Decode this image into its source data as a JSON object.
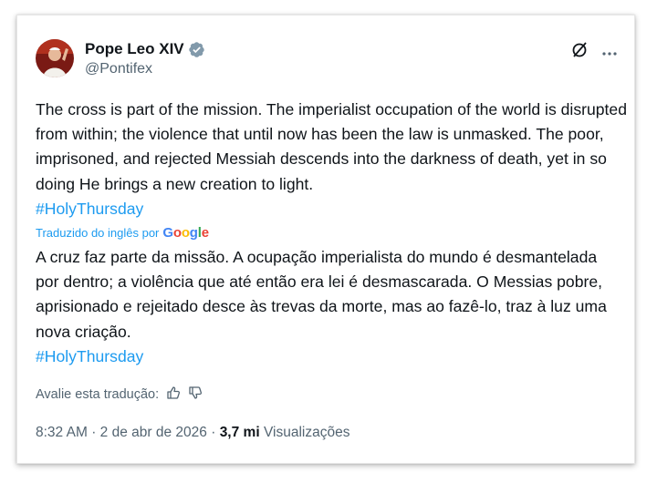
{
  "author": {
    "name": "Pope Leo XIV",
    "handle": "@Pontifex",
    "verified_icon": "verified-badge-icon",
    "verified_color": "#829aab"
  },
  "tweet": {
    "text": "The cross is part of the mission. The imperialist occupation of the world is disrupted from within; the violence that until now has been the law is unmasked. The poor, imprisoned, and rejected Messiah descends into the darkness of death, yet in so doing He brings a new creation to light.",
    "hashtag": "#HolyThursday"
  },
  "translation": {
    "label": "Traduzido do inglês por",
    "provider": "Google",
    "text": "A cruz faz parte da missão. A ocupação imperialista do mundo é desmantelada por dentro; a violência que até então era lei é desmascarada. O Messias pobre, aprisionado e rejeitado desce às trevas da morte, mas ao fazê-lo, traz à luz uma nova criação.",
    "hashtag": "#HolyThursday",
    "rate_label": "Avalie esta tradução:"
  },
  "meta": {
    "time": "8:32 AM",
    "separator": "·",
    "date": "2 de abr de 2026",
    "views_count": "3,7 mi",
    "views_label": "Visualizações"
  },
  "colors": {
    "link": "#1d9bf0",
    "text": "#0f1419",
    "secondary": "#536471"
  }
}
